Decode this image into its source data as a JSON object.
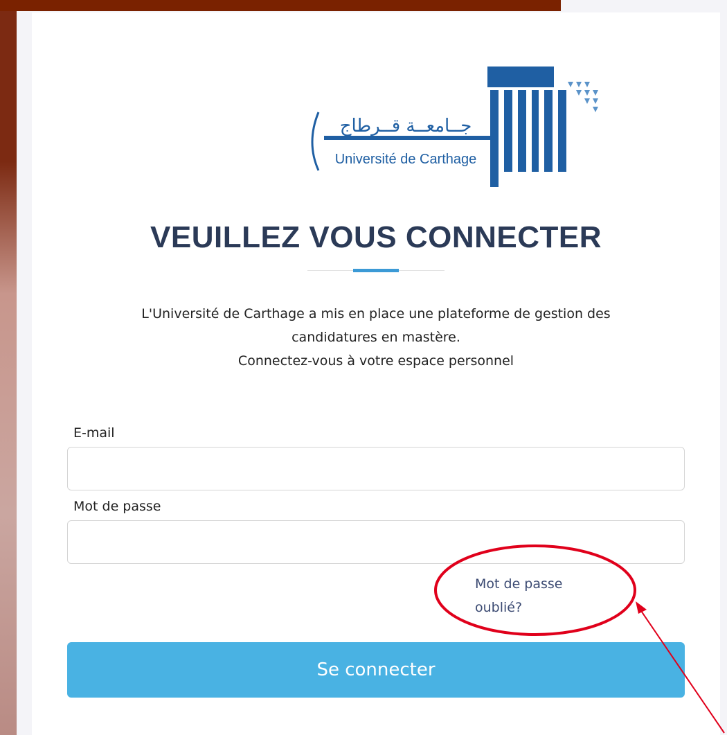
{
  "logo": {
    "arabic_text": "جــامعــة قــرطاج",
    "latin_text": "Université de Carthage",
    "brand_color": "#1f5fa3"
  },
  "page_title": "VEUILLEZ VOUS CONNECTER",
  "intro": {
    "line1": "L'Université de Carthage a mis en place une plateforme de gestion des",
    "line2": "candidatures en mastère.",
    "line3": "Connectez-vous à votre espace personnel"
  },
  "form": {
    "email_label": "E-mail",
    "email_value": "",
    "password_label": "Mot de passe",
    "password_value": "",
    "forgot_line1": "Mot de passe",
    "forgot_line2": "oublié?",
    "submit_label": "Se connecter"
  },
  "colors": {
    "title": "#2b3a57",
    "accent": "#3c9ad6",
    "button": "#49b2e3",
    "link": "#3b4a72",
    "annotation": "#e0001b"
  }
}
